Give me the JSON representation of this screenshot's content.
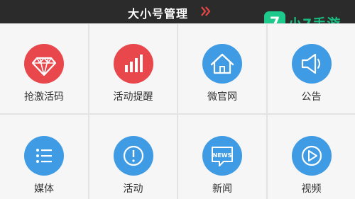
{
  "header": {
    "title": "大小号管理",
    "chevron_icon": "double-chevron-right-icon"
  },
  "watermark": {
    "text": "小7手游",
    "logo_glyph": "7",
    "logo_color": "#1ec98c"
  },
  "colors": {
    "red": "#e8474c",
    "blue": "#3e9be4"
  },
  "grid": {
    "row1": [
      {
        "label": "抢激活码",
        "icon": "diamond-icon",
        "color": "red"
      },
      {
        "label": "活动提醒",
        "icon": "bar-chart-icon",
        "color": "red"
      },
      {
        "label": "微官网",
        "icon": "home-icon",
        "color": "blue"
      },
      {
        "label": "公告",
        "icon": "speaker-icon",
        "color": "blue"
      }
    ],
    "row2": [
      {
        "label": "媒体",
        "icon": "list-icon",
        "color": "blue"
      },
      {
        "label": "活动",
        "icon": "alert-icon",
        "color": "blue"
      },
      {
        "label": "新闻",
        "icon": "news-icon",
        "color": "blue",
        "badge": "NEWS"
      },
      {
        "label": "视频",
        "icon": "play-icon",
        "color": "blue"
      }
    ]
  }
}
